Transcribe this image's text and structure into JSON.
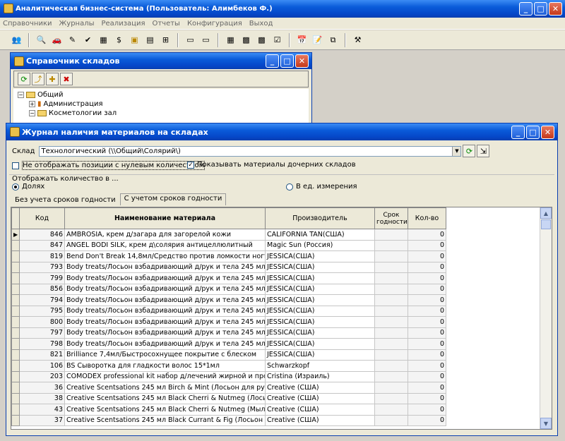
{
  "app": {
    "title": "Аналитическая бизнес-система  (Пользователь: Алимбеков Ф.)"
  },
  "menu": [
    "Справочники",
    "Журналы",
    "Реализация",
    "Отчеты",
    "Конфигурация",
    "Выход"
  ],
  "toolbar_icons": [
    "people-icon",
    "search-doc-icon",
    "car-icon",
    "pen-icon",
    "check-icon",
    "building-icon",
    "dollar-icon",
    "folder-icon",
    "box-icon",
    "tree-icon",
    "window-icon",
    "window2-icon",
    "grid-icon",
    "table-icon",
    "table2-icon",
    "checklist-icon",
    "calendar-icon",
    "note-icon",
    "copy-icon",
    "tools-icon"
  ],
  "warehouse_window": {
    "title": "Справочник складов",
    "tree": [
      {
        "label": "Общий",
        "level": 0,
        "toggle": "−"
      },
      {
        "label": "Администрация",
        "level": 1,
        "toggle": "+"
      },
      {
        "label": "Косметологии зал",
        "level": 1,
        "toggle": "−"
      },
      {
        "label": "...",
        "level": 2,
        "toggle": ""
      }
    ]
  },
  "journal": {
    "title": "Журнал наличия материалов на складах",
    "warehouse_label": "Склад",
    "warehouse_value": "Технологический (\\\\Общий\\Солярий\\)",
    "chk_zero": {
      "label": "Не отображать позиции с нулевым количеством",
      "checked": false
    },
    "chk_child": {
      "label": "Показывать материалы дочерних складов",
      "checked": true
    },
    "qty_group_label": "Отображать количество в ...",
    "radio_shares": {
      "label": "Долях",
      "checked": true
    },
    "radio_units": {
      "label": "В ед. измерения",
      "checked": false
    },
    "tabs": [
      "Без учета сроков годности",
      "С учетом сроков годности"
    ],
    "active_tab": 1,
    "columns": [
      "Код",
      "Наименование материала",
      "Производитель",
      "Срок годности",
      "Кол-во"
    ],
    "rows": [
      {
        "code": "846",
        "name": "AMBROSIA, крем д/загара для загорелой кожи",
        "maker": "CALIFORNIA TAN(США)",
        "qty": "0"
      },
      {
        "code": "847",
        "name": "ANGEL BODI SILK, крем д\\солярия антицеллюлитный",
        "maker": "Magic Sun (Россия)",
        "qty": "0"
      },
      {
        "code": "819",
        "name": "Bend Don't Break 14,8мл/Средство против ломкости ногтей",
        "maker": "JESSICA(США)",
        "qty": "0"
      },
      {
        "code": "793",
        "name": "Body treats/Лосьон взбадривающий д/рук и тела 245 мл(лаванд",
        "maker": "JESSICA(США)",
        "qty": "0"
      },
      {
        "code": "799",
        "name": "Body treats/Лосьон взбадривающий д/рук и тела 245 мл(Мед-Не",
        "maker": "JESSICA(США)",
        "qty": "0"
      },
      {
        "code": "856",
        "name": "Body treats/Лосьон взбадривающий д/рук и тела 245 мл(огурец-",
        "maker": "JESSICA(США)",
        "qty": "0"
      },
      {
        "code": "794",
        "name": "Body treats/Лосьон взбадривающий д/рук и тела 245 мл(Рай)",
        "maker": "JESSICA(США)",
        "qty": "0"
      },
      {
        "code": "795",
        "name": "Body treats/Лосьон взбадривающий д/рук и тела 245 мл(Роза)",
        "maker": "JESSICA(США)",
        "qty": "0"
      },
      {
        "code": "800",
        "name": "Body treats/Лосьон взбадривающий д/рук и тела 245 мл(Цветы)",
        "maker": "JESSICA(США)",
        "qty": "0"
      },
      {
        "code": "797",
        "name": "Body treats/Лосьон взбадривающий д/рук и тела 245 мл(Цитрус",
        "maker": "JESSICA(США)",
        "qty": "0"
      },
      {
        "code": "798",
        "name": "Body treats/Лосьон взбадривающий д/рук и тела 245 мл(Череш",
        "maker": "JESSICA(США)",
        "qty": "0"
      },
      {
        "code": "821",
        "name": "Brilliance 7,4мл/Быстросохнущее покрытие с блеском",
        "maker": "JESSICA(США)",
        "qty": "0"
      },
      {
        "code": "106",
        "name": "BS Сыворотка для гладкости волос 15*1мл",
        "maker": "Schwarzkopf",
        "qty": "0"
      },
      {
        "code": "203",
        "name": "COMODEX professional kit набор д/лечений жирной и проблемно",
        "maker": "Cristina (Израиль)",
        "qty": "0"
      },
      {
        "code": "36",
        "name": "Creative Scentsations 245 мл Birch & Mint (Лосьон для рук и тела)",
        "maker": "Creative (США)",
        "qty": "0"
      },
      {
        "code": "38",
        "name": "Creative Scentsations 245 мл Black Cherri & Nutmeg (Лосьон для р",
        "maker": "Creative (США)",
        "qty": "0"
      },
      {
        "code": "43",
        "name": "Creative Scentsations 245 мл Black Cherri & Nutmeg (Мыло для рук",
        "maker": "Creative (США)",
        "qty": "0"
      },
      {
        "code": "37",
        "name": "Creative Scentsations 245 мл Black Currant & Fig (Лосьон для рук и",
        "maker": "Creative (США)",
        "qty": "0"
      }
    ]
  }
}
